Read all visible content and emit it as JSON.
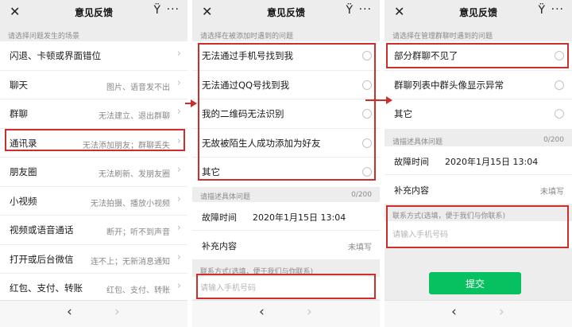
{
  "colors": {
    "accent_green": "#07c160",
    "highlight_red": "#c9302c",
    "page_bg": "#ededed"
  },
  "icons": {
    "close": "close-icon",
    "more": "more-dots-icon",
    "debug": "tuning-fork-icon",
    "chevron": "chevron-right-icon",
    "back": "back-arrow-icon",
    "forward": "forward-arrow-icon"
  },
  "nav": {
    "title": "意见反馈",
    "close_glyph": "✕",
    "fork_glyph": "Ÿ",
    "more_glyph": "···"
  },
  "bottom": {
    "back_glyph": "‹",
    "forward_glyph": "›"
  },
  "panel1": {
    "hint": "请选择问题发生的场景",
    "rows": [
      {
        "label": "闪退、卡顿或界面错位",
        "desc": ""
      },
      {
        "label": "聊天",
        "desc": "图片、语音发不出"
      },
      {
        "label": "群聊",
        "desc": "无法建立、退出群聊"
      },
      {
        "label": "通讯录",
        "desc": "无法添加朋友；群聊丢失"
      },
      {
        "label": "朋友圈",
        "desc": "无法刷新、发朋友圈"
      },
      {
        "label": "小视频",
        "desc": "无法拍摄、播放小视频"
      },
      {
        "label": "视频或语音通话",
        "desc": "断开；听不到声音"
      },
      {
        "label": "打开或后台微信",
        "desc": "连不上；无新消息通知"
      },
      {
        "label": "红包、支付、转账",
        "desc": "红包、支付、转账"
      }
    ]
  },
  "panel2": {
    "hint": "请选择在被添加时遇到的问题",
    "options": [
      "无法通过手机号找到我",
      "无法通过QQ号找到我",
      "我的二维码无法识别",
      "无故被陌生人成功添加为好友",
      "其它"
    ],
    "desc_hint": "请描述具体问题",
    "counter": "0/200",
    "time_label": "故障时间",
    "time_value": "2020年1月15日 13:04",
    "extra_label": "补充内容",
    "extra_value": "未填写",
    "contact_label": "联系方式(选填，便于我们与你联系)",
    "phone_placeholder": "请输入手机号码"
  },
  "panel3": {
    "hint": "请选择在管理群聊时遇到的问题",
    "options": [
      "部分群聊不见了",
      "群聊列表中群头像显示异常",
      "其它"
    ],
    "desc_hint": "请描述具体问题",
    "counter": "0/200",
    "time_label": "故障时间",
    "time_value": "2020年1月15日 13:04",
    "extra_label": "补充内容",
    "extra_value": "未填写",
    "contact_label": "联系方式(选填，便于我们与你联系)",
    "phone_placeholder": "请输入手机号码",
    "submit_label": "提交"
  }
}
